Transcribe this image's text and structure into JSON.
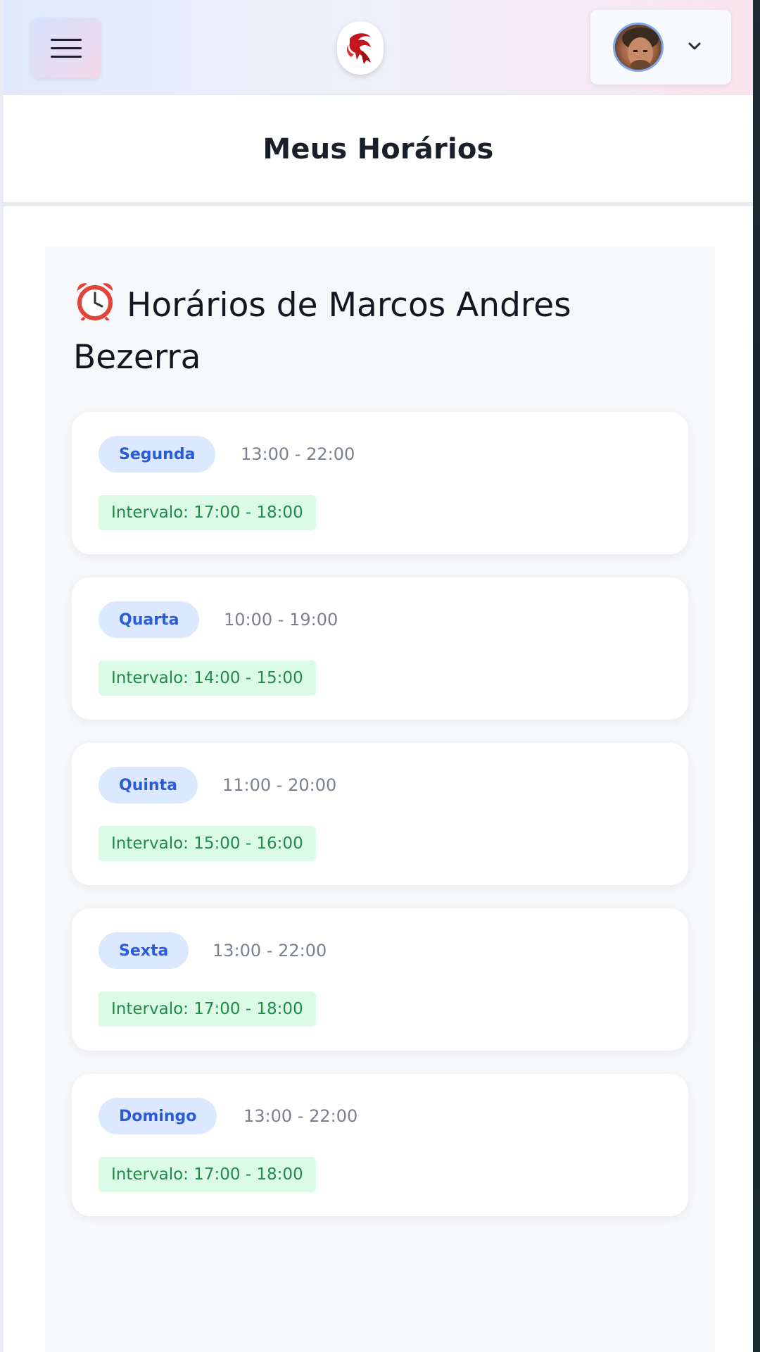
{
  "header": {
    "menu_icon": "hamburger-icon",
    "logo_icon": "dragon-logo-icon",
    "avatar": "user-avatar",
    "chevron_icon": "chevron-down-icon"
  },
  "page": {
    "title": "Meus Horários"
  },
  "schedule": {
    "heading_icon": "alarm-clock-icon",
    "heading": "Horários de Marcos Andres Bezerra",
    "items": [
      {
        "day": "Segunda",
        "time": "13:00 - 22:00",
        "interval": "Intervalo: 17:00 - 18:00"
      },
      {
        "day": "Quarta",
        "time": "10:00 - 19:00",
        "interval": "Intervalo: 14:00 - 15:00"
      },
      {
        "day": "Quinta",
        "time": "11:00 - 20:00",
        "interval": "Intervalo: 15:00 - 16:00"
      },
      {
        "day": "Sexta",
        "time": "13:00 - 22:00",
        "interval": "Intervalo: 17:00 - 18:00"
      },
      {
        "day": "Domingo",
        "time": "13:00 - 22:00",
        "interval": "Intervalo: 17:00 - 18:00"
      }
    ]
  },
  "colors": {
    "day_pill_bg": "#dce8fd",
    "day_pill_text": "#2c5bd8",
    "interval_bg": "#dcfbe6",
    "interval_text": "#1f8a4a"
  }
}
